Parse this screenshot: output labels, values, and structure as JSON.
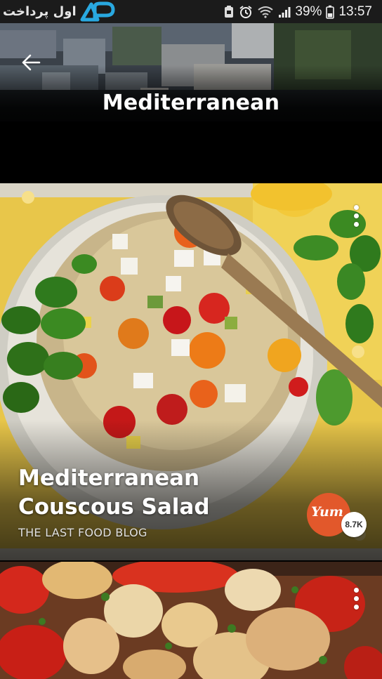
{
  "status_bar": {
    "brand_text": "اول پرداخت",
    "battery": "39%",
    "time": "13:57"
  },
  "header": {
    "title": "Mediterranean"
  },
  "recipes": [
    {
      "title": "Mediterranean Couscous Salad",
      "source": "THE LAST FOOD BLOG",
      "yum_label": "Yum",
      "yum_count": "8.7K"
    },
    {
      "title": "",
      "source": ""
    }
  ],
  "icons": {
    "back": "arrow-left-icon",
    "more": "more-vertical-icon",
    "status": [
      "alarm-icon",
      "wifi-icon",
      "signal-icon",
      "battery-icon"
    ]
  },
  "colors": {
    "yum_accent": "#e2582b",
    "status_bar_bg": "#1b1b1b",
    "brand_logo_blue": "#29a8e0"
  }
}
